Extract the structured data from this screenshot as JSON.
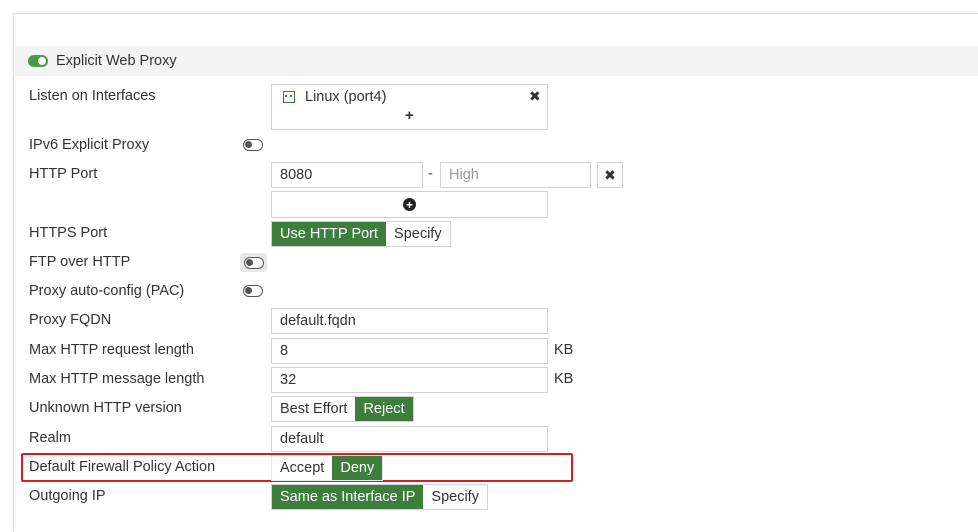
{
  "section": {
    "title": "Explicit Web Proxy",
    "enabled": true
  },
  "listen_interfaces": {
    "label": "Listen on Interfaces",
    "items": [
      "Linux (port4)"
    ],
    "add": "+",
    "remove": "✖"
  },
  "ipv6": {
    "label": "IPv6 Explicit Proxy",
    "enabled": false
  },
  "http_port": {
    "label": "HTTP Port",
    "low": "8080",
    "dash": "-",
    "high_placeholder": "High",
    "remove": "✖",
    "add": "+"
  },
  "https_port": {
    "label": "HTTPS Port",
    "options": [
      "Use HTTP Port",
      "Specify"
    ],
    "selected": "Use HTTP Port"
  },
  "ftp": {
    "label": "FTP over HTTP",
    "enabled": false
  },
  "pac": {
    "label": "Proxy auto-config (PAC)",
    "enabled": false
  },
  "fqdn": {
    "label": "Proxy FQDN",
    "value": "default.fqdn"
  },
  "max_request": {
    "label": "Max HTTP request length",
    "value": "8",
    "unit": "KB"
  },
  "max_message": {
    "label": "Max HTTP message length",
    "value": "32",
    "unit": "KB"
  },
  "unknown_version": {
    "label": "Unknown HTTP version",
    "options": [
      "Best Effort",
      "Reject"
    ],
    "selected": "Reject"
  },
  "realm": {
    "label": "Realm",
    "value": "default"
  },
  "firewall_action": {
    "label": "Default Firewall Policy Action",
    "options": [
      "Accept",
      "Deny"
    ],
    "selected": "Deny"
  },
  "outgoing_ip": {
    "label": "Outgoing IP",
    "options": [
      "Same as Interface IP",
      "Specify"
    ],
    "selected": "Same as Interface IP"
  },
  "colors": {
    "accent": "#3d7e3d",
    "highlight": "#d21f1f",
    "header_bg": "#f3f3f3"
  }
}
